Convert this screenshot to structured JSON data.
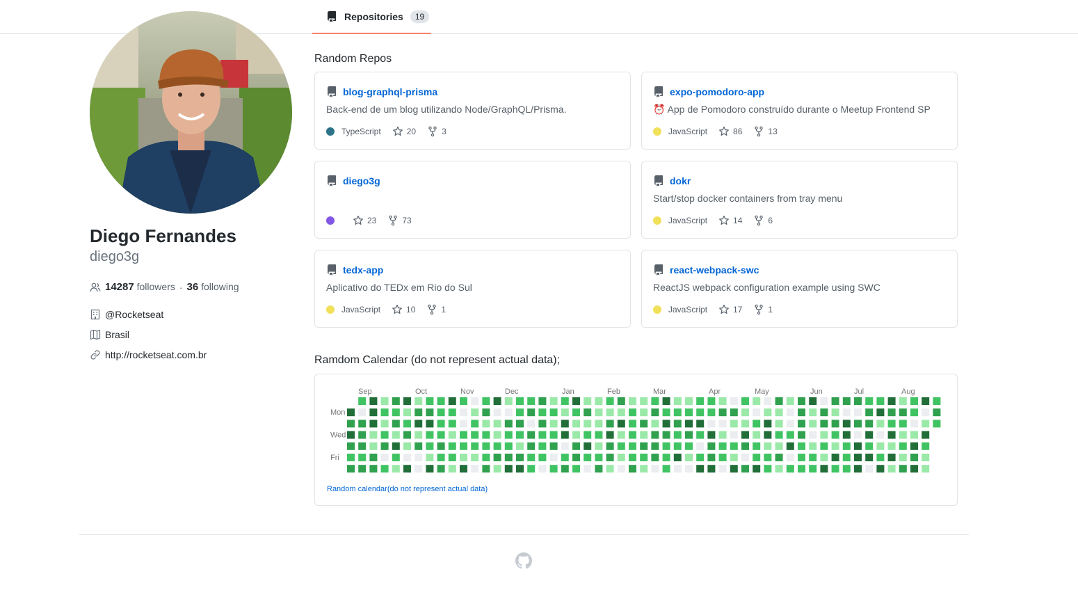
{
  "tabs": [
    {
      "label": "Repositories",
      "count": "19",
      "icon": "repo-icon"
    }
  ],
  "profile": {
    "name": "Diego Fernandes",
    "login": "diego3g",
    "followers": "14287",
    "followers_label": "followers",
    "separator": "·",
    "following": "36",
    "following_label": "following",
    "company": "@Rocketseat",
    "location": "Brasil",
    "blog": "http://rocketseat.com.br"
  },
  "repos_title": "Random Repos",
  "repos": [
    {
      "name": "blog-graphql-prisma",
      "description": "Back-end de um blog utilizando Node/GraphQL/Prisma.",
      "language": "TypeScript",
      "language_color": "#2b7489",
      "stars": "20",
      "forks": "3"
    },
    {
      "name": "expo-pomodoro-app",
      "description": "App de Pomodoro construído durante o Meetup Frontend SP",
      "emoji": "⏰",
      "language": "JavaScript",
      "language_color": "#f1e05a",
      "stars": "86",
      "forks": "13"
    },
    {
      "name": "diego3g",
      "description": "",
      "language": "",
      "language_color": "#8257e5",
      "stars": "23",
      "forks": "73"
    },
    {
      "name": "dokr",
      "description": "Start/stop docker containers from tray menu",
      "language": "JavaScript",
      "language_color": "#f1e05a",
      "stars": "14",
      "forks": "6"
    },
    {
      "name": "tedx-app",
      "description": "Aplicativo do TEDx em Rio do Sul",
      "language": "JavaScript",
      "language_color": "#f1e05a",
      "stars": "10",
      "forks": "1"
    },
    {
      "name": "react-webpack-swc",
      "description": "ReactJS webpack configuration example using SWC",
      "language": "JavaScript",
      "language_color": "#f1e05a",
      "stars": "17",
      "forks": "1"
    }
  ],
  "calendar": {
    "title": "Ramdom Calendar (do not represent actual data);",
    "months": [
      "Sep",
      "Oct",
      "Nov",
      "Dec",
      "Jan",
      "Feb",
      "Mar",
      "Apr",
      "May",
      "Jun",
      "Jul",
      "Aug"
    ],
    "days": [
      "Mon",
      "Wed",
      "Fri"
    ],
    "colors": [
      "#ebedf0",
      "#9be9a8",
      "#40c463",
      "#30a14e",
      "#216e39"
    ],
    "footer": "Random calendar(do not represent actual data)"
  },
  "footer": {
    "logo": "github-logo-icon"
  }
}
